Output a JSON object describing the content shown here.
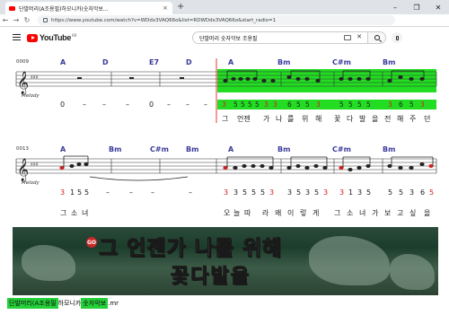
{
  "browser": {
    "tab_title": "단발머리(A조용필)하모니카(숫자악보...",
    "tab_close": "×",
    "new_tab": "+",
    "url": "https://www.youtube.com/watch?v=WDdx3VAQ66o&list=RDWDdx3VAQ66o&start_radio=1",
    "window_controls": [
      "–",
      "❐",
      "✕"
    ]
  },
  "youtube": {
    "logo_text": "YouTube",
    "logo_region": "KR",
    "search_query": "단발머리 숫자악보 조용필",
    "clear_label": "✕"
  },
  "sheet": {
    "system1": {
      "measure_no": "0009",
      "staff_label": "Melody",
      "chords": [
        "A",
        "D",
        "E7",
        "D",
        "A",
        "Bm",
        "C#m",
        "Bm"
      ],
      "numbers": [
        "0",
        "–",
        "–",
        "–",
        "0",
        "–",
        "–",
        "–",
        "3",
        "5",
        "5",
        "5",
        "5",
        "3",
        "3",
        "3",
        "6",
        "5",
        "5",
        "3",
        "5",
        "5",
        "5",
        "5",
        "3",
        "3",
        "3",
        "6",
        "5"
      ],
      "lyrics": [
        "그",
        "언젠",
        "가",
        "나",
        "를",
        "위",
        "해",
        "꽃",
        "다",
        "발",
        "을",
        "전",
        "해",
        "주",
        "던"
      ]
    },
    "system2": {
      "measure_no": "0013",
      "staff_label": "Melody",
      "chords": [
        "A",
        "Bm",
        "C#m",
        "Bm",
        "A",
        "Bm",
        "C#m",
        "Bm"
      ],
      "numbers": [
        "3",
        "1",
        "5",
        "5",
        "–",
        "–",
        "–",
        "–",
        "3",
        "3",
        "5",
        "5",
        "5",
        "3",
        "3",
        "3",
        "5",
        "3",
        "5",
        "3",
        "3",
        "1",
        "3",
        "5",
        "5",
        "5",
        "3",
        "3",
        "3",
        "6",
        "5"
      ],
      "lyrics": [
        "그",
        "소",
        "녀",
        "오",
        "늘",
        "따",
        "라",
        "왜",
        "이",
        "렇",
        "게",
        "그",
        "소",
        "녀",
        "가",
        "보",
        "고",
        "싶",
        "을"
      ]
    }
  },
  "karaoke": {
    "badge": "GO",
    "line1_sung": "그 언젠가",
    "line1_rest": " 나를 위해",
    "line2": "꽃다발을"
  },
  "video_caption": {
    "highlighted_start": "단발머리(A조용필",
    "middle": "하모니카",
    "highlighted_end": "숫자악보",
    "end": ".mr"
  },
  "colors": {
    "highlight": "#22dd22",
    "chord_text": "#3a3a9a",
    "red_number": "#d32020",
    "playhead": "#e53935",
    "youtube_red": "#ff0000"
  }
}
